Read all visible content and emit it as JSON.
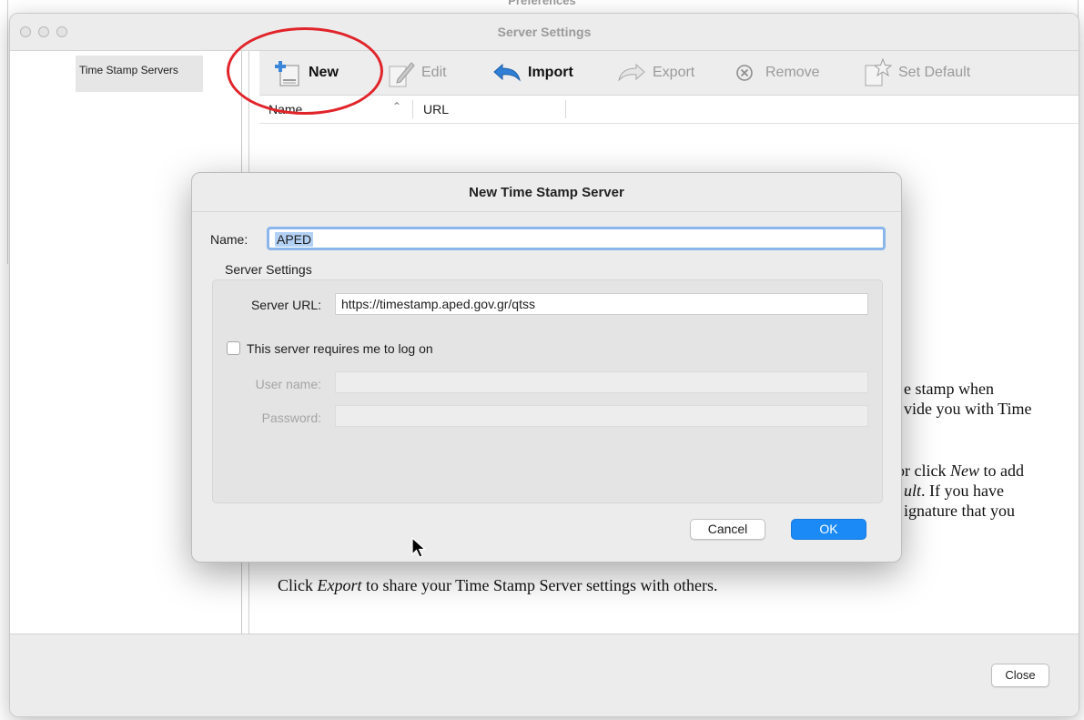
{
  "behind_window": {
    "title": "Preferences"
  },
  "window": {
    "title": "Server Settings"
  },
  "sidebar": {
    "items": [
      {
        "label": "Time Stamp Servers",
        "selected": true
      }
    ]
  },
  "toolbar": {
    "buttons": [
      {
        "label": "New",
        "icon": "new-server-icon",
        "enabled": true
      },
      {
        "label": "Edit",
        "icon": "pencil-icon",
        "enabled": false
      },
      {
        "label": "Import",
        "icon": "import-arrow-icon",
        "enabled": true
      },
      {
        "label": "Export",
        "icon": "export-arrow-icon",
        "enabled": false
      },
      {
        "label": "Remove",
        "icon": "remove-x-icon",
        "enabled": false
      },
      {
        "label": "Set Default",
        "icon": "set-default-star-icon",
        "enabled": false
      }
    ]
  },
  "table": {
    "columns": [
      {
        "label": "Name",
        "sorted": "ascending"
      },
      {
        "label": "URL"
      }
    ]
  },
  "help_text": {
    "line1": "e stamp when",
    "line2": "vide you with Time",
    "line3_pre": "or click ",
    "line3_em": "New",
    "line3_post": " to add",
    "line4_em": "ult",
    "line4_post": ". If you have",
    "line5": "ignature that you",
    "line6_pre": "Click ",
    "line6_em": "Export",
    "line6_post": " to share your Time Stamp Server settings with others."
  },
  "footer": {
    "close_label": "Close"
  },
  "annotation": {
    "color": "#e0242a",
    "target": "New"
  },
  "dialog": {
    "title": "New Time Stamp Server",
    "name_label": "Name:",
    "name_value": "APED",
    "group_label": "Server Settings",
    "server_url_label": "Server URL:",
    "server_url_value": "https://timestamp.aped.gov.gr/qtss",
    "login_checkbox_label": "This server requires me to log on",
    "login_checked": false,
    "username_label": "User name:",
    "username_value": "",
    "password_label": "Password:",
    "password_value": "",
    "cancel_label": "Cancel",
    "ok_label": "OK"
  },
  "colors": {
    "accent": "#1b8af6",
    "focus_ring": "#8ab6ec",
    "selection": "#b3d1f5"
  }
}
